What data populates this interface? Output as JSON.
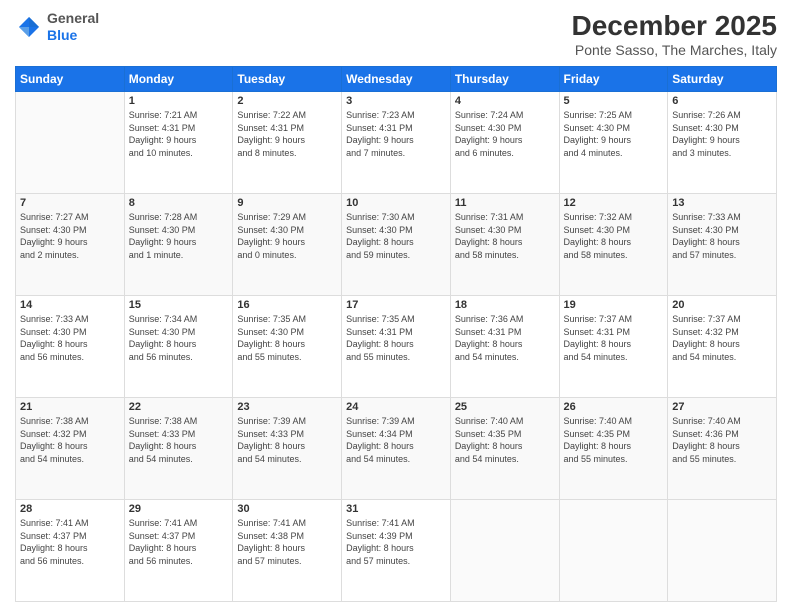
{
  "header": {
    "logo_general": "General",
    "logo_blue": "Blue",
    "month": "December 2025",
    "location": "Ponte Sasso, The Marches, Italy"
  },
  "weekdays": [
    "Sunday",
    "Monday",
    "Tuesday",
    "Wednesday",
    "Thursday",
    "Friday",
    "Saturday"
  ],
  "weeks": [
    [
      {
        "day": "",
        "info": ""
      },
      {
        "day": "1",
        "info": "Sunrise: 7:21 AM\nSunset: 4:31 PM\nDaylight: 9 hours\nand 10 minutes."
      },
      {
        "day": "2",
        "info": "Sunrise: 7:22 AM\nSunset: 4:31 PM\nDaylight: 9 hours\nand 8 minutes."
      },
      {
        "day": "3",
        "info": "Sunrise: 7:23 AM\nSunset: 4:31 PM\nDaylight: 9 hours\nand 7 minutes."
      },
      {
        "day": "4",
        "info": "Sunrise: 7:24 AM\nSunset: 4:30 PM\nDaylight: 9 hours\nand 6 minutes."
      },
      {
        "day": "5",
        "info": "Sunrise: 7:25 AM\nSunset: 4:30 PM\nDaylight: 9 hours\nand 4 minutes."
      },
      {
        "day": "6",
        "info": "Sunrise: 7:26 AM\nSunset: 4:30 PM\nDaylight: 9 hours\nand 3 minutes."
      }
    ],
    [
      {
        "day": "7",
        "info": "Sunrise: 7:27 AM\nSunset: 4:30 PM\nDaylight: 9 hours\nand 2 minutes."
      },
      {
        "day": "8",
        "info": "Sunrise: 7:28 AM\nSunset: 4:30 PM\nDaylight: 9 hours\nand 1 minute."
      },
      {
        "day": "9",
        "info": "Sunrise: 7:29 AM\nSunset: 4:30 PM\nDaylight: 9 hours\nand 0 minutes."
      },
      {
        "day": "10",
        "info": "Sunrise: 7:30 AM\nSunset: 4:30 PM\nDaylight: 8 hours\nand 59 minutes."
      },
      {
        "day": "11",
        "info": "Sunrise: 7:31 AM\nSunset: 4:30 PM\nDaylight: 8 hours\nand 58 minutes."
      },
      {
        "day": "12",
        "info": "Sunrise: 7:32 AM\nSunset: 4:30 PM\nDaylight: 8 hours\nand 58 minutes."
      },
      {
        "day": "13",
        "info": "Sunrise: 7:33 AM\nSunset: 4:30 PM\nDaylight: 8 hours\nand 57 minutes."
      }
    ],
    [
      {
        "day": "14",
        "info": "Sunrise: 7:33 AM\nSunset: 4:30 PM\nDaylight: 8 hours\nand 56 minutes."
      },
      {
        "day": "15",
        "info": "Sunrise: 7:34 AM\nSunset: 4:30 PM\nDaylight: 8 hours\nand 56 minutes."
      },
      {
        "day": "16",
        "info": "Sunrise: 7:35 AM\nSunset: 4:30 PM\nDaylight: 8 hours\nand 55 minutes."
      },
      {
        "day": "17",
        "info": "Sunrise: 7:35 AM\nSunset: 4:31 PM\nDaylight: 8 hours\nand 55 minutes."
      },
      {
        "day": "18",
        "info": "Sunrise: 7:36 AM\nSunset: 4:31 PM\nDaylight: 8 hours\nand 54 minutes."
      },
      {
        "day": "19",
        "info": "Sunrise: 7:37 AM\nSunset: 4:31 PM\nDaylight: 8 hours\nand 54 minutes."
      },
      {
        "day": "20",
        "info": "Sunrise: 7:37 AM\nSunset: 4:32 PM\nDaylight: 8 hours\nand 54 minutes."
      }
    ],
    [
      {
        "day": "21",
        "info": "Sunrise: 7:38 AM\nSunset: 4:32 PM\nDaylight: 8 hours\nand 54 minutes."
      },
      {
        "day": "22",
        "info": "Sunrise: 7:38 AM\nSunset: 4:33 PM\nDaylight: 8 hours\nand 54 minutes."
      },
      {
        "day": "23",
        "info": "Sunrise: 7:39 AM\nSunset: 4:33 PM\nDaylight: 8 hours\nand 54 minutes."
      },
      {
        "day": "24",
        "info": "Sunrise: 7:39 AM\nSunset: 4:34 PM\nDaylight: 8 hours\nand 54 minutes."
      },
      {
        "day": "25",
        "info": "Sunrise: 7:40 AM\nSunset: 4:35 PM\nDaylight: 8 hours\nand 54 minutes."
      },
      {
        "day": "26",
        "info": "Sunrise: 7:40 AM\nSunset: 4:35 PM\nDaylight: 8 hours\nand 55 minutes."
      },
      {
        "day": "27",
        "info": "Sunrise: 7:40 AM\nSunset: 4:36 PM\nDaylight: 8 hours\nand 55 minutes."
      }
    ],
    [
      {
        "day": "28",
        "info": "Sunrise: 7:41 AM\nSunset: 4:37 PM\nDaylight: 8 hours\nand 56 minutes."
      },
      {
        "day": "29",
        "info": "Sunrise: 7:41 AM\nSunset: 4:37 PM\nDaylight: 8 hours\nand 56 minutes."
      },
      {
        "day": "30",
        "info": "Sunrise: 7:41 AM\nSunset: 4:38 PM\nDaylight: 8 hours\nand 57 minutes."
      },
      {
        "day": "31",
        "info": "Sunrise: 7:41 AM\nSunset: 4:39 PM\nDaylight: 8 hours\nand 57 minutes."
      },
      {
        "day": "",
        "info": ""
      },
      {
        "day": "",
        "info": ""
      },
      {
        "day": "",
        "info": ""
      }
    ]
  ]
}
